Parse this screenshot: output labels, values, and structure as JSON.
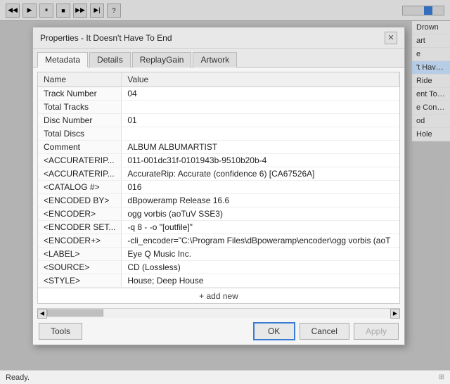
{
  "toolbar": {
    "buttons": [
      "prev",
      "play",
      "pause",
      "stop",
      "next",
      "next2",
      "info"
    ]
  },
  "background_list": {
    "items": [
      {
        "label": "Drown",
        "selected": false
      },
      {
        "label": "art",
        "selected": false
      },
      {
        "label": "e",
        "selected": false
      },
      {
        "label": "'t Have ...",
        "selected": true
      },
      {
        "label": "Ride",
        "selected": false
      },
      {
        "label": "ent To S...",
        "selected": false
      },
      {
        "label": "e Control",
        "selected": false
      },
      {
        "label": "od",
        "selected": false
      },
      {
        "label": "Hole",
        "selected": false
      }
    ]
  },
  "dialog": {
    "title": "Properties - It Doesn't Have To End",
    "close_label": "✕",
    "tabs": [
      {
        "label": "Metadata",
        "active": true
      },
      {
        "label": "Details",
        "active": false
      },
      {
        "label": "ReplayGain",
        "active": false
      },
      {
        "label": "Artwork",
        "active": false
      }
    ],
    "table": {
      "headers": [
        "Name",
        "Value"
      ],
      "rows": [
        {
          "name": "Track Number",
          "value": "04"
        },
        {
          "name": "Total Tracks",
          "value": ""
        },
        {
          "name": "Disc Number",
          "value": "01"
        },
        {
          "name": "Total Discs",
          "value": ""
        },
        {
          "name": "Comment",
          "value": "ALBUM ALBUMARTIST"
        },
        {
          "name": "<ACCURATERIP...",
          "value": "011-001dc31f-0101943b-9510b20b-4"
        },
        {
          "name": "<ACCURATERIP...",
          "value": "AccurateRip: Accurate (confidence 6)   [CA67526A]"
        },
        {
          "name": "<CATALOG #>",
          "value": "016"
        },
        {
          "name": "<ENCODED BY>",
          "value": "dBpoweramp Release 16.6"
        },
        {
          "name": "<ENCODER>",
          "value": "ogg vorbis (aoTuV SSE3)"
        },
        {
          "name": "<ENCODER SET...",
          "value": "-q 8 - -o \"[outfile]\""
        },
        {
          "name": "<ENCODER+>",
          "value": "  -cli_encoder=\"C:\\Program Files\\dBpoweramp\\encoder\\ogg vorbis (aoT"
        },
        {
          "name": "<LABEL>",
          "value": "Eye Q Music Inc."
        },
        {
          "name": "<SOURCE>",
          "value": "CD (Lossless)"
        },
        {
          "name": "<STYLE>",
          "value": "House; Deep House"
        }
      ],
      "add_new": "+ add new"
    },
    "footer": {
      "tools_label": "Tools",
      "ok_label": "OK",
      "cancel_label": "Cancel",
      "apply_label": "Apply"
    }
  },
  "status_bar": {
    "text": "Ready."
  }
}
